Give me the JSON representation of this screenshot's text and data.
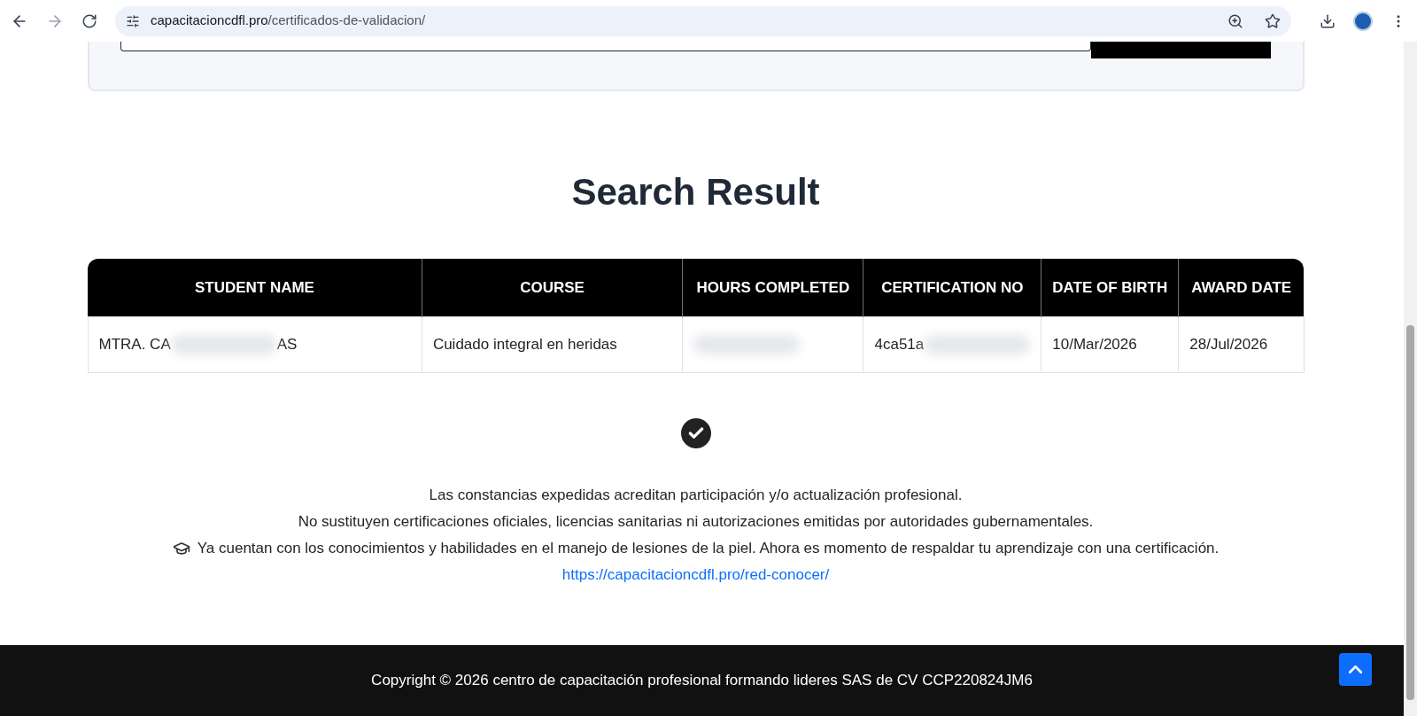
{
  "browser": {
    "url_host": "capacitacioncdfl.pro",
    "url_path": "/certificados-de-validacion/"
  },
  "heading": "Search Result",
  "table": {
    "columns": [
      "STUDENT NAME",
      "COURSE",
      "HOURS COMPLETED",
      "CERTIFICATION NO",
      "DATE OF BIRTH",
      "AWARD DATE"
    ],
    "rows": [
      {
        "cells": [
          {
            "text_start": "MTRA. CA",
            "text_end": "AS",
            "redacted": true
          },
          {
            "text_start": "Cuidado integral en heridas",
            "redacted": false
          },
          {
            "redacted": true
          },
          {
            "text_start": "4ca51a",
            "redacted": true
          },
          {
            "text_start": "10/Mar/2026",
            "redacted": false
          },
          {
            "text_start": "28/Jul/2026",
            "redacted": false
          }
        ]
      }
    ]
  },
  "notes": [
    "Las constancias expedidas acreditan participación y/o actualización profesional.",
    "No sustituyen certificaciones oficiales, licencias sanitarias ni autorizaciones emitidas por autoridades gubernamentales.",
    "Ya cuentan con los conocimientos y habilidades en el manejo de lesiones de la piel. Ahora es momento de respaldar tu aprendizaje con una certificación."
  ],
  "link": "https://capacitacioncdfl.pro/red-conocer/",
  "footer": "Copyright © 2026 centro de capacitación profesional formando lideres SAS de CV CCP220824JM6"
}
